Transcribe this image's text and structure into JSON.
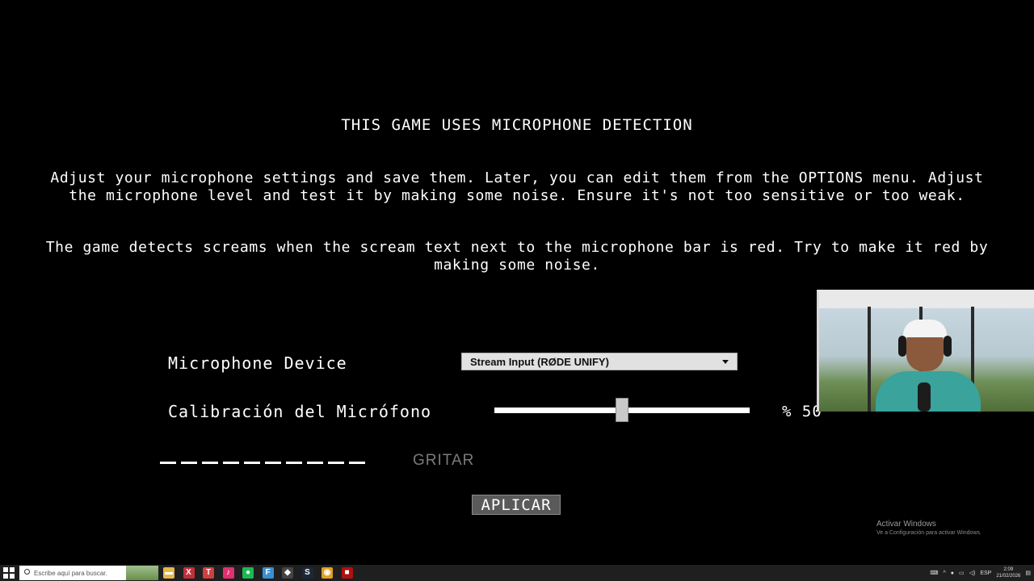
{
  "screen": {
    "title": "THIS GAME USES MICROPHONE DETECTION",
    "paragraph1": "Adjust your microphone settings and save them. Later, you can edit them from the OPTIONS menu. Adjust the microphone level and test it by making some noise. Ensure it's not too sensitive or too weak.",
    "paragraph2": "The game detects screams when the scream text next to the microphone bar is red. Try to make it red by making some noise."
  },
  "settings": {
    "device_label": "Microphone Device",
    "device_value": "Stream Input (RØDE UNIFY)",
    "calibration_label": "Calibración del Micrófono",
    "calibration_value_text": "% 50",
    "calibration_level": 0.5,
    "scream_label": "GRITAR",
    "scream_label_color": "#7a7a7a",
    "apply_label": "APLICAR"
  },
  "watermark": {
    "title": "Activar Windows",
    "subtitle": "Ve a Configuración para activar Windows."
  },
  "taskbar": {
    "search_placeholder": "Escribe aquí para buscar.",
    "apps": [
      {
        "icon": "folder-icon",
        "color": "#e6b84a",
        "glyph": "▬"
      },
      {
        "icon": "x-app-icon",
        "color": "#c0303a",
        "glyph": "X"
      },
      {
        "icon": "t-app-icon",
        "color": "#d04040",
        "glyph": "T"
      },
      {
        "icon": "tiktok-icon",
        "color": "#e03070",
        "glyph": "♪"
      },
      {
        "icon": "spotify-icon",
        "color": "#1db954",
        "glyph": "●"
      },
      {
        "icon": "f-app-icon",
        "color": "#3a8fd0",
        "glyph": "F"
      },
      {
        "icon": "game-app-icon",
        "color": "#444",
        "glyph": "◆"
      },
      {
        "icon": "steam-icon",
        "color": "#1b2838",
        "glyph": "S"
      },
      {
        "icon": "chrome-icon",
        "color": "#e0a020",
        "glyph": "◉"
      },
      {
        "icon": "red-app-icon",
        "color": "#b01010",
        "glyph": "■"
      }
    ],
    "tray_lang": "ESP",
    "time": "2:09",
    "date": "21/02/2026"
  }
}
